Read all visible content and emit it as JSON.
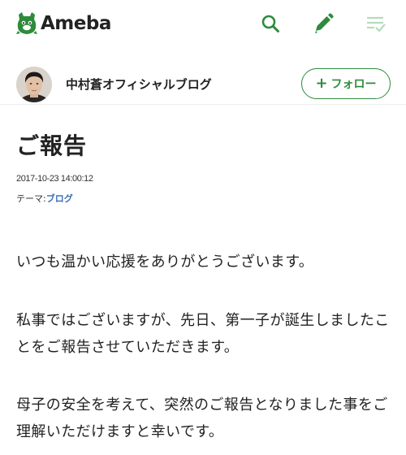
{
  "header": {
    "logo_text": "Ameba",
    "brand_color": "#2d8c3c",
    "icons": [
      "search-icon",
      "pencil-icon",
      "feed-icon"
    ]
  },
  "blog": {
    "title": "中村蒼オフィシャルブログ",
    "follow_plus": "+",
    "follow_label": "フォロー"
  },
  "entry": {
    "title": "ご報告",
    "date": "2017-10-23 14:00:12",
    "theme_prefix": "テーマ:",
    "theme_link": "ブログ",
    "paragraphs": [
      "いつも温かい応援をありがとうございます。",
      "私事ではございますが、先日、第一子が誕生しましたことをご報告させていただきます。",
      "母子の安全を考えて、突然のご報告となりました事をご理解いただけますと幸いです。"
    ]
  },
  "colors": {
    "accent": "#2d8c3c",
    "link": "#3b6eb5",
    "text": "#222222"
  }
}
